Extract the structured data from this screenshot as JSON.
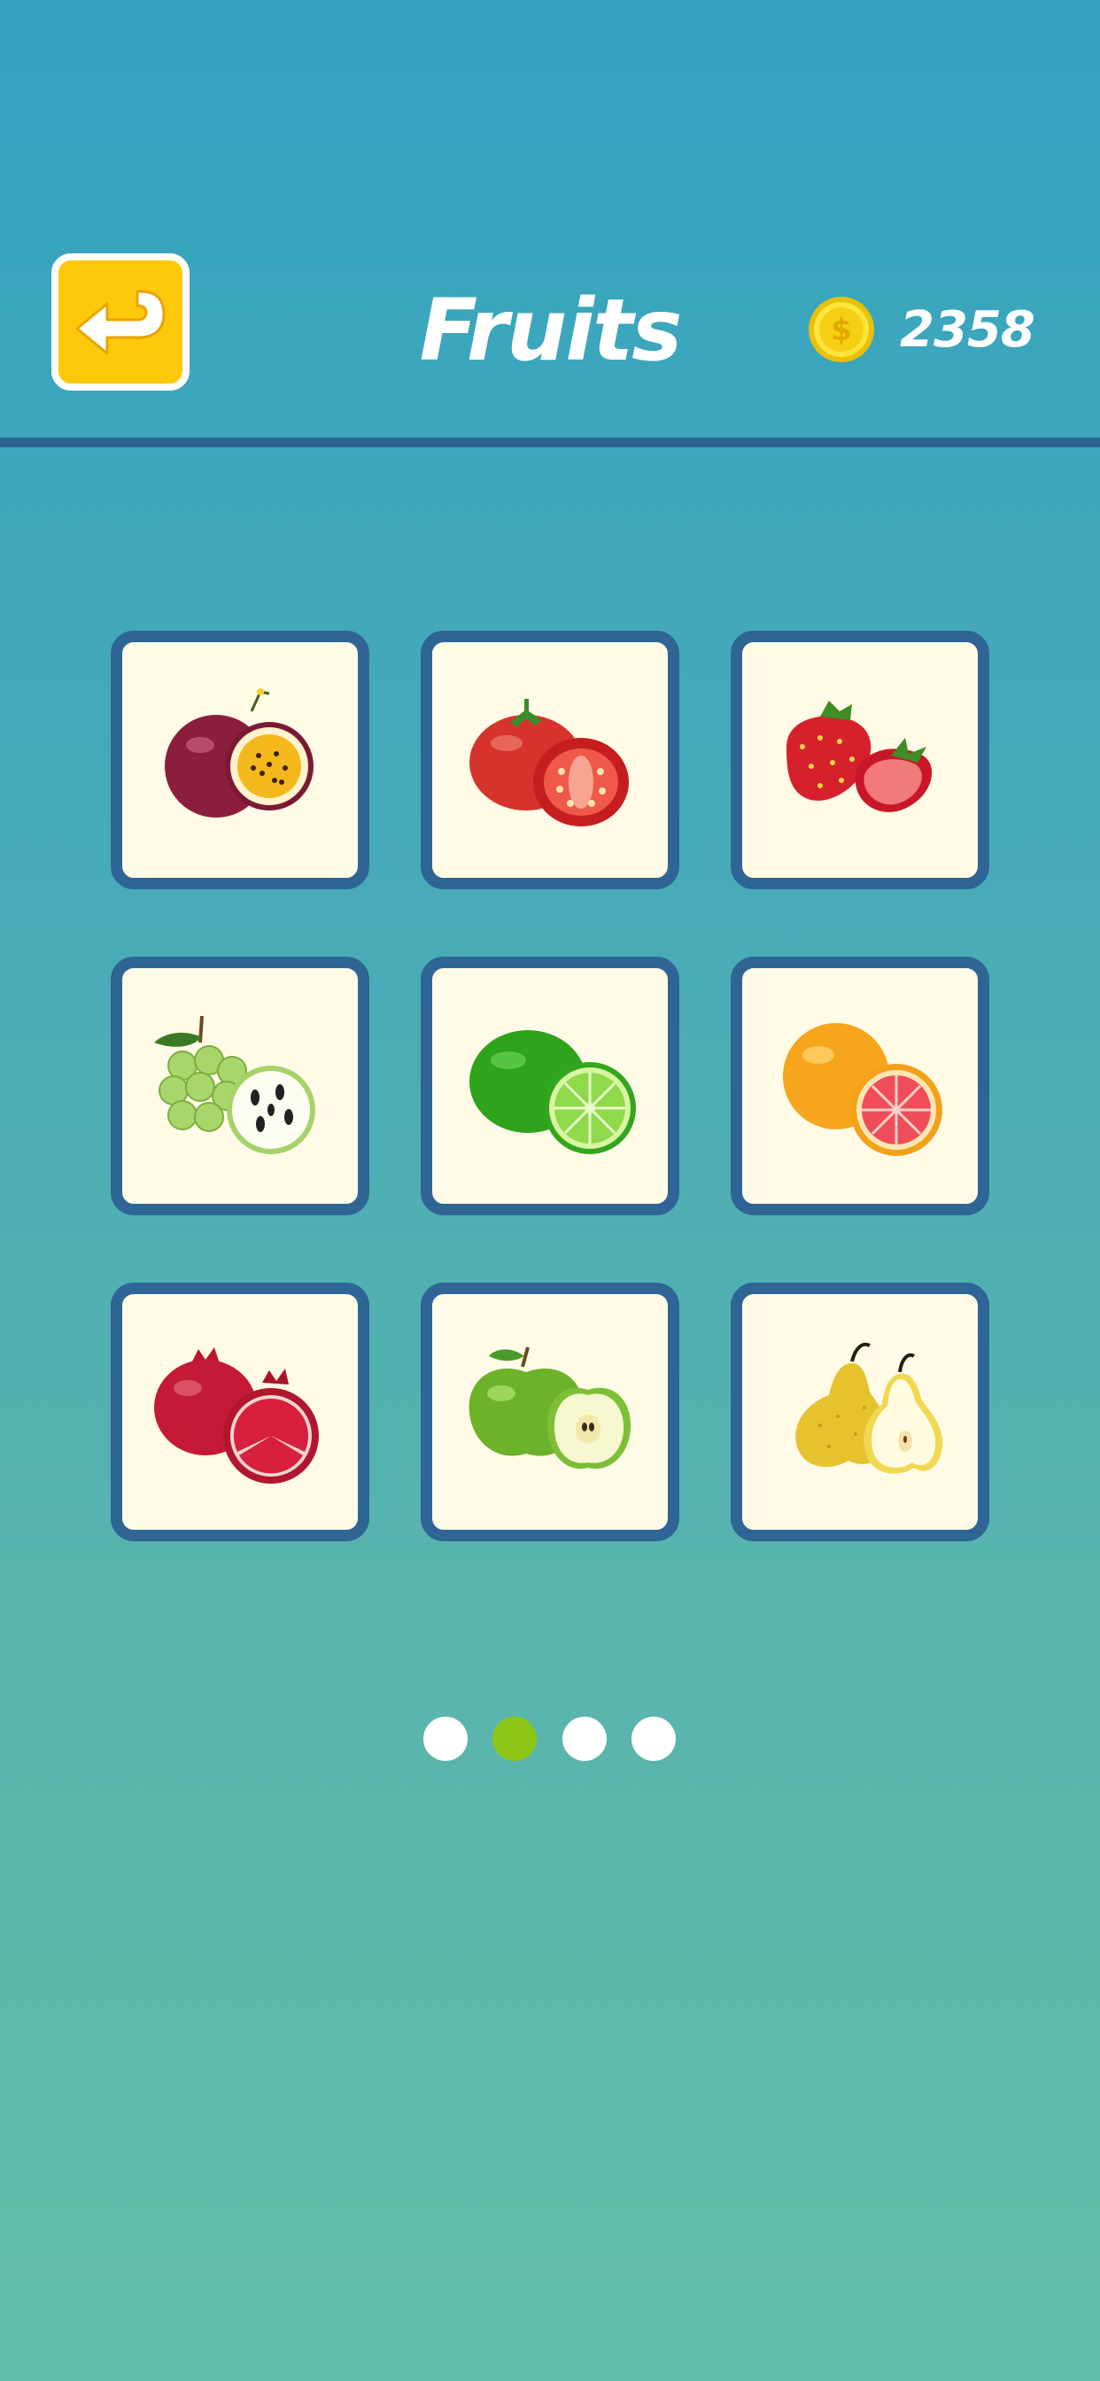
{
  "header": {
    "title": "Fruits",
    "coins": "2358",
    "back_icon": "return-arrow-icon",
    "coin_icon": "dollar-coin-icon"
  },
  "colors": {
    "background_top": "#33a3bf",
    "background_bottom": "#63bea7",
    "header_line": "#2d6591",
    "back_button": "#ffc90b",
    "card_border": "#2e6595",
    "card_fill": "#fffbe6",
    "dot_active": "#8cc716",
    "dot_inactive": "#ffffff"
  },
  "grid": {
    "items": [
      {
        "icon": "passion-fruit-icon"
      },
      {
        "icon": "tomato-icon"
      },
      {
        "icon": "strawberry-icon"
      },
      {
        "icon": "custard-apple-icon"
      },
      {
        "icon": "lime-icon"
      },
      {
        "icon": "grapefruit-icon"
      },
      {
        "icon": "pomegranate-icon"
      },
      {
        "icon": "green-apple-icon"
      },
      {
        "icon": "pear-icon"
      }
    ]
  },
  "pagination": {
    "total": 4,
    "current": 2
  }
}
